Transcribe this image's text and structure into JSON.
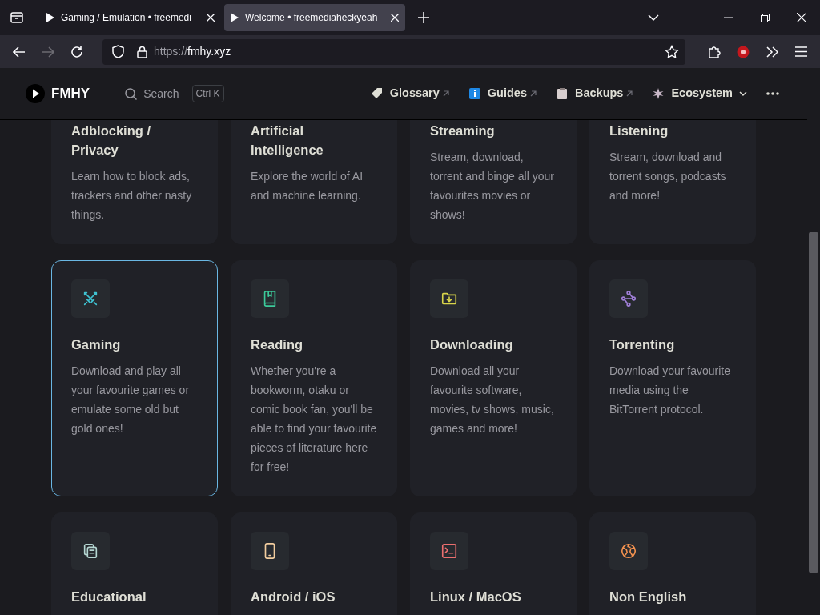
{
  "browser": {
    "tabs": [
      {
        "title": "Gaming / Emulation • freemedi",
        "selected": false
      },
      {
        "title": "Welcome • freemediaheckyeah",
        "selected": true
      }
    ],
    "url_scheme": "https://",
    "url_host": "fmhy.xyz"
  },
  "site": {
    "logo_text": "FMHY",
    "search": {
      "placeholder": "Search",
      "shortcut": "Ctrl K"
    },
    "nav": [
      {
        "label": "Glossary",
        "kind": "external"
      },
      {
        "label": "Guides",
        "kind": "external"
      },
      {
        "label": "Backups",
        "kind": "external"
      },
      {
        "label": "Ecosystem",
        "kind": "dropdown"
      }
    ]
  },
  "categories": [
    {
      "title": "Adblocking / Privacy",
      "description": "Learn how to block ads, trackers and other nasty things.",
      "selected": false
    },
    {
      "title": "Artificial Intelligence",
      "description": "Explore the world of AI and machine learning.",
      "selected": false
    },
    {
      "title": "Streaming",
      "description": "Stream, download, torrent and binge all your favourites movies or shows!",
      "selected": false
    },
    {
      "title": "Listening",
      "description": "Stream, download and torrent songs, podcasts and more!",
      "selected": false
    },
    {
      "title": "Gaming",
      "description": "Download and play all your favourite games or emulate some old but gold ones!",
      "color": "#3fc1d0",
      "selected": true
    },
    {
      "title": "Reading",
      "description": "Whether you're a bookworm, otaku or comic book fan, you'll be able to find your favourite pieces of literature here for free!",
      "color": "#3cc99a",
      "selected": false
    },
    {
      "title": "Downloading",
      "description": "Download all your favourite software, movies, tv shows, music, games and more!",
      "color": "#d9d54a",
      "selected": false
    },
    {
      "title": "Torrenting",
      "description": "Download your favourite media using the BitTorrent protocol.",
      "color": "#a07fd8",
      "selected": false
    },
    {
      "title": "Educational",
      "color": "#b5d6d2",
      "selected": false
    },
    {
      "title": "Android / iOS",
      "color": "#f2cd9f",
      "selected": false
    },
    {
      "title": "Linux / MacOS",
      "color": "#ec6f6f",
      "selected": false
    },
    {
      "title": "Non English",
      "color": "#f4924f",
      "selected": false
    }
  ]
}
